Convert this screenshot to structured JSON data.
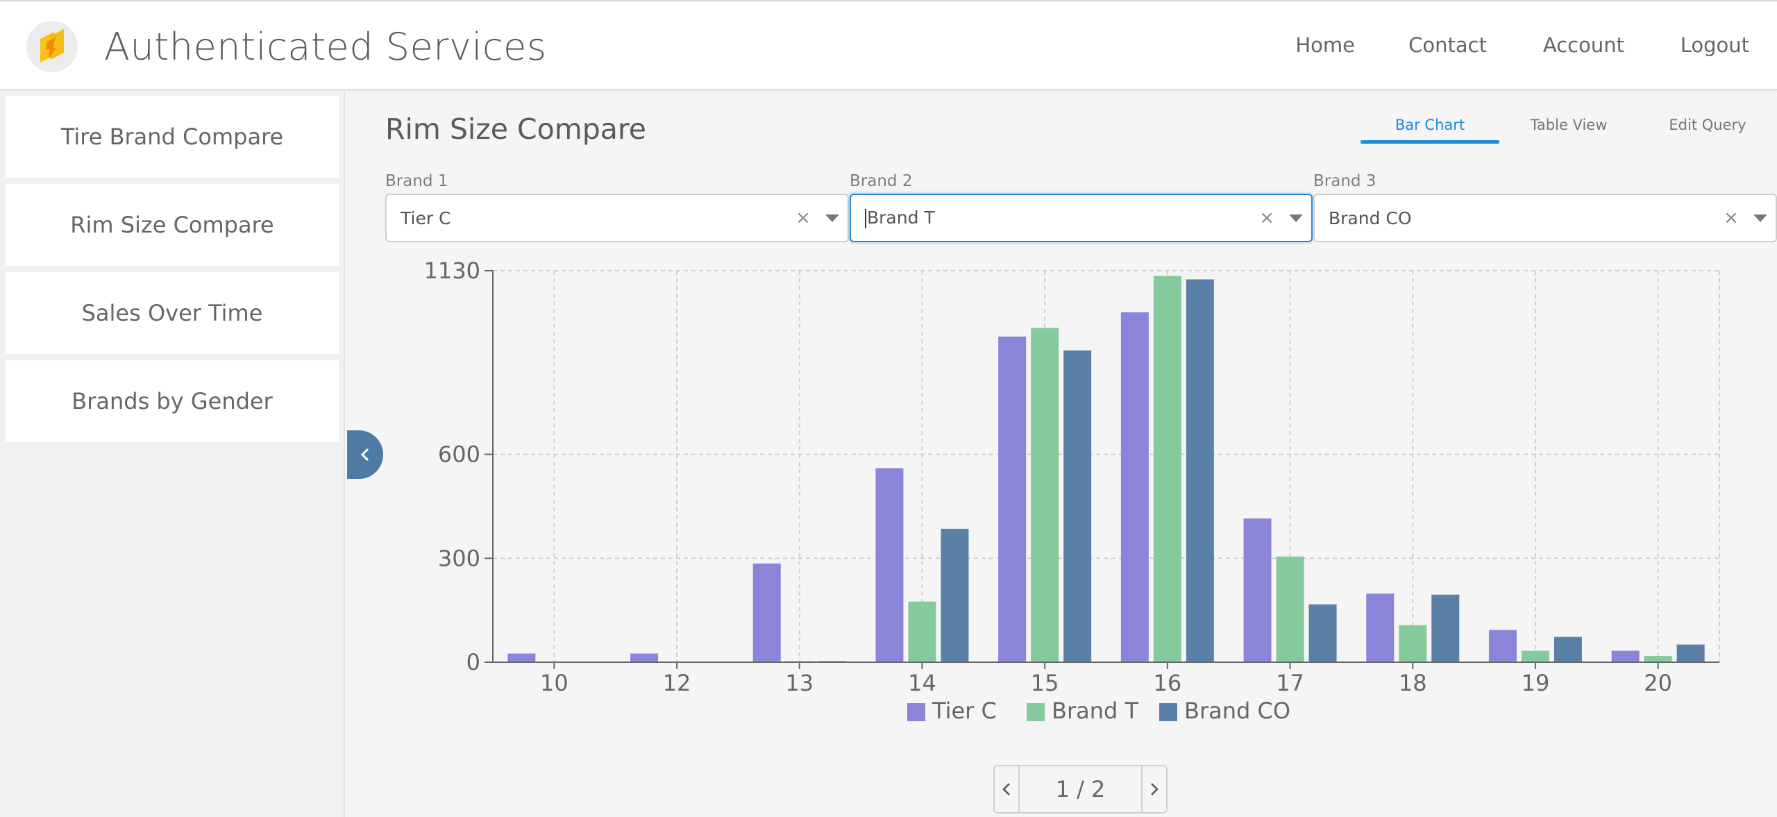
{
  "header": {
    "title": "Authenticated Services",
    "nav": [
      "Home",
      "Contact",
      "Account",
      "Logout"
    ]
  },
  "sidebar": {
    "items": [
      {
        "label": "Tire Brand Compare"
      },
      {
        "label": "Rim Size Compare"
      },
      {
        "label": "Sales Over Time"
      },
      {
        "label": "Brands by Gender"
      }
    ]
  },
  "main": {
    "title": "Rim Size Compare",
    "tabs": [
      {
        "label": "Bar Chart",
        "active": true
      },
      {
        "label": "Table View",
        "active": false
      },
      {
        "label": "Edit Query",
        "active": false
      }
    ],
    "filters": [
      {
        "label": "Brand 1",
        "value": "Tier C",
        "focused": false
      },
      {
        "label": "Brand 2",
        "value": "Brand T",
        "focused": true
      },
      {
        "label": "Brand 3",
        "value": "Brand CO",
        "focused": false
      }
    ],
    "pager": {
      "current": "1",
      "separator": "/",
      "total": "2"
    }
  },
  "colors": {
    "accent": "#1a8ed8",
    "collapse_button": "#4f7aa4",
    "series": [
      "#8b85d9",
      "#85c99d",
      "#5a80a8"
    ]
  },
  "icons": {
    "logo": "lightning-bolt-logo",
    "collapse": "chevron-left-icon",
    "pager_prev": "chevron-left-icon",
    "pager_next": "chevron-right-icon",
    "clear": "close-icon",
    "dropdown": "caret-down-icon"
  },
  "chart_data": {
    "type": "bar",
    "categories": [
      "10",
      "12",
      "13",
      "14",
      "15",
      "16",
      "17",
      "18",
      "19",
      "20"
    ],
    "series": [
      {
        "name": "Tier C",
        "values": [
          25,
          25,
          285,
          560,
          940,
          1010,
          415,
          198,
          93,
          33
        ]
      },
      {
        "name": "Brand T",
        "values": [
          0,
          0,
          3,
          175,
          965,
          1115,
          305,
          107,
          33,
          18
        ]
      },
      {
        "name": "Brand CO",
        "values": [
          0,
          0,
          3,
          385,
          900,
          1105,
          167,
          195,
          73,
          51
        ]
      }
    ],
    "yticks": [
      0,
      300,
      600,
      1130
    ],
    "ylim": [
      0,
      1130
    ],
    "grid": true,
    "legend": "bottom-center"
  }
}
